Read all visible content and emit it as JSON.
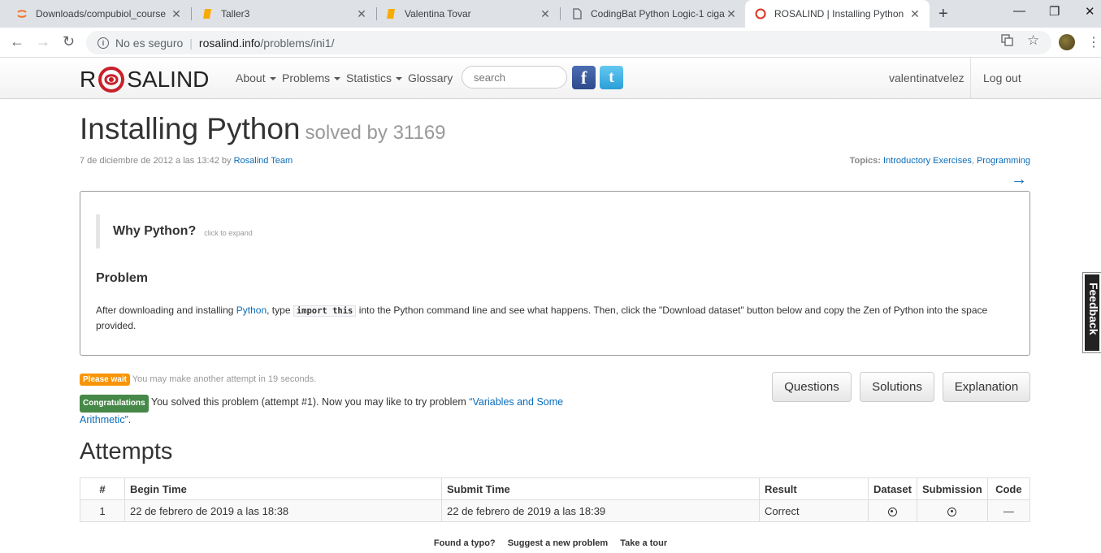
{
  "browser": {
    "tabs": [
      {
        "title": "Downloads/compubiol_course",
        "icon": "jupyter-icon",
        "active": false
      },
      {
        "title": "Taller3",
        "icon": "notebook-icon",
        "active": false
      },
      {
        "title": "Valentina Tovar",
        "icon": "notebook-icon",
        "active": false
      },
      {
        "title": "CodingBat Python Logic-1 ciga",
        "icon": "page-icon",
        "active": false
      },
      {
        "title": "ROSALIND | Installing Python",
        "icon": "rosalind-icon",
        "active": true
      }
    ],
    "close_glyph": "✕",
    "new_tab_glyph": "+",
    "address": {
      "security": "No es seguro",
      "host": "rosalind.info",
      "path": "/problems/ini1/"
    }
  },
  "nav": {
    "logo_left": "R",
    "logo_right": "SALIND",
    "menu": [
      "About",
      "Problems",
      "Statistics",
      "Glossary"
    ],
    "search_placeholder": "search",
    "facebook": "f",
    "twitter": "t",
    "user": "valentinatvelez",
    "logout": "Log out"
  },
  "problem": {
    "title": "Installing Python",
    "solved_by": "solved by 31169",
    "date": "7 de diciembre de 2012 a las 13:42 by",
    "author": "Rosalind Team",
    "topics_label": "Topics:",
    "topics": [
      "Introductory Exercises",
      "Programming"
    ],
    "topics_sep": ", ",
    "next_arrow": "→",
    "why_title": "Why Python?",
    "why_hint": "click to expand",
    "problem_heading": "Problem",
    "text_1": "After downloading and installing ",
    "text_link": "Python",
    "text_2": ", type ",
    "text_code": "import this",
    "text_3": " into the Python command line and see what happens. Then, click the \"Download dataset\" button below and copy the Zen of Python into the space provided."
  },
  "status": {
    "wait_badge": "Please wait",
    "wait_text": " You may make another attempt in 19 seconds.",
    "congrats_badge": "Congratulations",
    "congrats_text": " You solved this problem (attempt #1). Now you may like to try problem ",
    "next_problem": "“Variables and Some Arithmetic”",
    "congrats_end": "."
  },
  "buttons": {
    "questions": "Questions",
    "solutions": "Solutions",
    "explanation": "Explanation"
  },
  "attempts": {
    "heading": "Attempts",
    "columns": [
      "#",
      "Begin Time",
      "Submit Time",
      "Result",
      "Dataset",
      "Submission",
      "Code"
    ],
    "rows": [
      {
        "num": "1",
        "begin": "22 de febrero de 2019 a las 18:38",
        "submit": "22 de febrero de 2019 a las 18:39",
        "result": "Correct",
        "code": "—"
      }
    ]
  },
  "footer": [
    "Found a typo?",
    "Suggest a new problem",
    "Take a tour"
  ],
  "feedback": "Feedback",
  "colors": {
    "link": "#0a6cba",
    "warning": "#f89406",
    "success": "#468847"
  }
}
